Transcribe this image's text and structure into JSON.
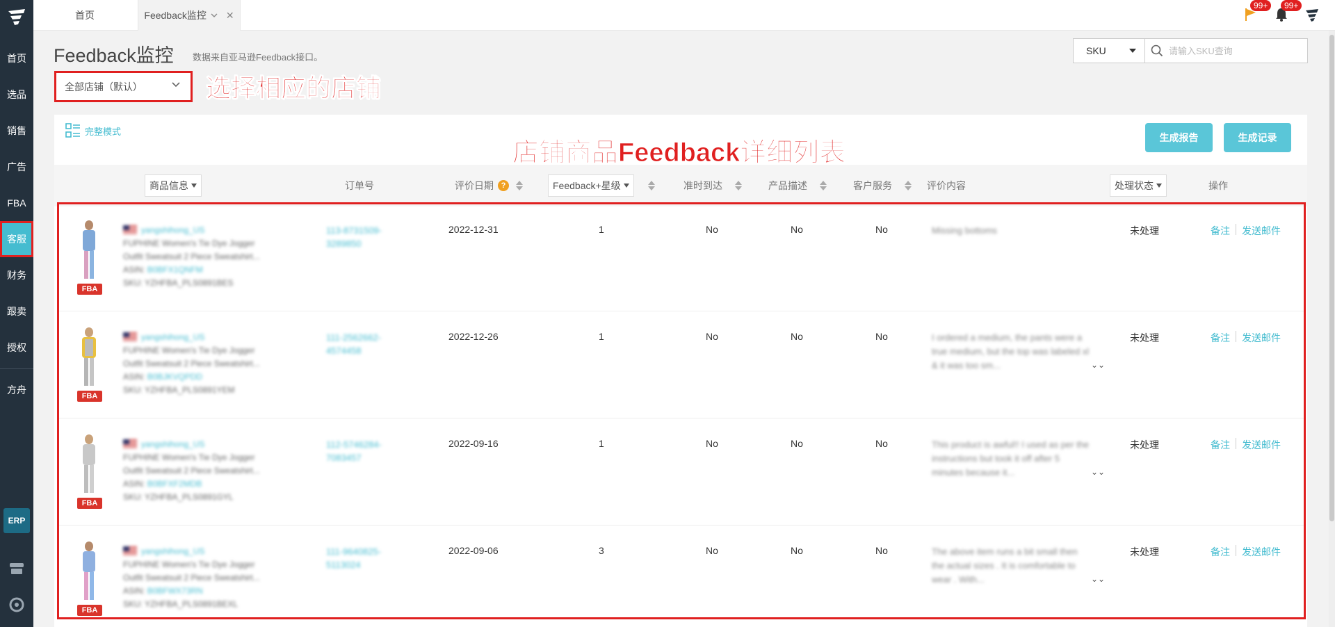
{
  "sidebar": {
    "items": [
      {
        "label": "首页"
      },
      {
        "label": "选品"
      },
      {
        "label": "销售"
      },
      {
        "label": "广告"
      },
      {
        "label": "FBA"
      },
      {
        "label": "客服"
      },
      {
        "label": "财务"
      },
      {
        "label": "跟卖"
      },
      {
        "label": "授权"
      },
      {
        "label": "方舟"
      }
    ],
    "erp_label": "ERP",
    "active": "客服"
  },
  "tabs": {
    "home": "首页",
    "active": "Feedback监控"
  },
  "top_icons": {
    "flag_badge": "99+",
    "bell_badge": "99+"
  },
  "header": {
    "title": "Feedback监控",
    "subtitle": "数据来自亚马逊Feedback接口。",
    "store_select": "全部店铺（默认）",
    "annotation_store": "选择相应的店铺",
    "annotation_list": "店铺商品Feedback详细列表"
  },
  "search": {
    "type": "SKU",
    "placeholder": "请输入SKU查询"
  },
  "panel": {
    "mode_label": "完整模式",
    "btn_report": "生成报告",
    "btn_record": "生成记录"
  },
  "table": {
    "headers": {
      "product": "商品信息",
      "order": "订单号",
      "date": "评价日期",
      "feedback": "Feedback+星级",
      "ontime": "准时到达",
      "desc": "产品描述",
      "service": "客户服务",
      "review": "评价内容",
      "status": "处理状态",
      "ops": "操作"
    },
    "rows": [
      {
        "store": "yangshihong_US",
        "title1": "FUPHINE Women's Tie Dye Jogger",
        "title2": "Outfit Sweatsuit 2 Piece Sweatshirt...",
        "asin_label": "ASIN:",
        "asin": "B0BFX1QNFM",
        "sku": "SKU: YZHFBA_PLS0891BES",
        "order": "113-8731509-3289850",
        "date": "2022-12-31",
        "star": "1",
        "ontime": "No",
        "desc": "No",
        "service": "No",
        "review": "Missing bottoms",
        "status": "未处理",
        "op_note": "备注",
        "op_mail": "发送邮件",
        "fba": "FBA"
      },
      {
        "store": "yangshihong_US",
        "title1": "FUPHINE Women's Tie Dye Jogger",
        "title2": "Outfit Sweatsuit 2 Piece Sweatshirt...",
        "asin_label": "ASIN:",
        "asin": "B0BJKVQPDD",
        "sku": "SKU: YZHFBA_PLS0891YEM",
        "order": "111-2562662-4574458",
        "date": "2022-12-26",
        "star": "1",
        "ontime": "No",
        "desc": "No",
        "service": "No",
        "review": "I ordered a medium, the pants were a true medium, but the top was labeled xl & it was too sm...",
        "status": "未处理",
        "op_note": "备注",
        "op_mail": "发送邮件",
        "fba": "FBA"
      },
      {
        "store": "yangshihong_US",
        "title1": "FUPHINE Women's Tie Dye Jogger",
        "title2": "Outfit Sweatsuit 2 Piece Sweatshirt...",
        "asin_label": "ASIN:",
        "asin": "B0BFXF2MDB",
        "sku": "SKU: YZHFBA_PLS0891GYL",
        "order": "112-5746284-7083457",
        "date": "2022-09-16",
        "star": "1",
        "ontime": "No",
        "desc": "No",
        "service": "No",
        "review": "This product is awful!! I used as per the instructions but took it off after 5 minutes because it...",
        "status": "未处理",
        "op_note": "备注",
        "op_mail": "发送邮件",
        "fba": "FBA"
      },
      {
        "store": "yangshihong_US",
        "title1": "FUPHINE Women's Tie Dye Jogger",
        "title2": "Outfit Sweatsuit 2 Piece Sweatshirt...",
        "asin_label": "ASIN:",
        "asin": "B0BFWX73RN",
        "sku": "SKU: YZHFBA_PLS0891BEXL",
        "order": "111-9640825-5113024",
        "date": "2022-09-06",
        "star": "3",
        "ontime": "No",
        "desc": "No",
        "service": "No",
        "review": "The above item runs a bit small then the actual sizes . It is comfortable to wear . With...",
        "status": "未处理",
        "op_note": "备注",
        "op_mail": "发送邮件",
        "fba": "FBA"
      }
    ]
  },
  "colors": {
    "accent": "#45bcd0",
    "sidebar": "#24313d",
    "annotation": "#e02020"
  }
}
